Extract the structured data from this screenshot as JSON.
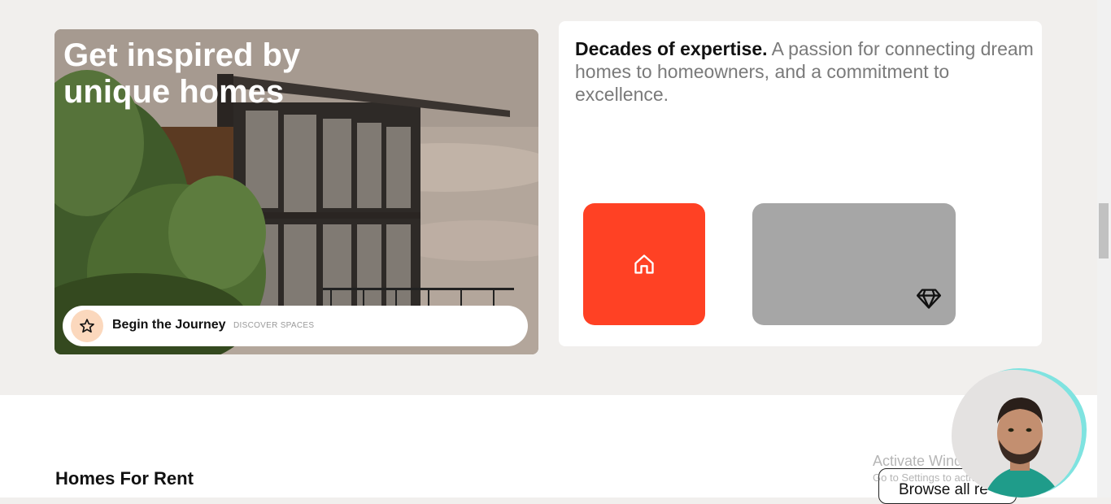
{
  "hero": {
    "title": "Get inspired by unique homes",
    "cta_label": "Begin the Journey",
    "cta_sub": "DISCOVER SPACES",
    "cta_icon": "star-icon"
  },
  "info": {
    "headline_bold": "Decades of expertise.",
    "headline_rest": " A passion for connecting dream homes to homeowners, and a commitment to excellence.",
    "tiles": [
      {
        "icon": "home-icon",
        "color": "#ff4124"
      },
      {
        "icon": "diamond-icon",
        "color": "#a6a6a6"
      }
    ]
  },
  "rent": {
    "title": "Homes For Rent",
    "browse_label": "Browse all re"
  },
  "watermark": {
    "title": "Activate Windows",
    "sub": "Go to Settings to activate Windows."
  },
  "colors": {
    "accent": "#ff4124",
    "page_bg": "#f1efed"
  }
}
